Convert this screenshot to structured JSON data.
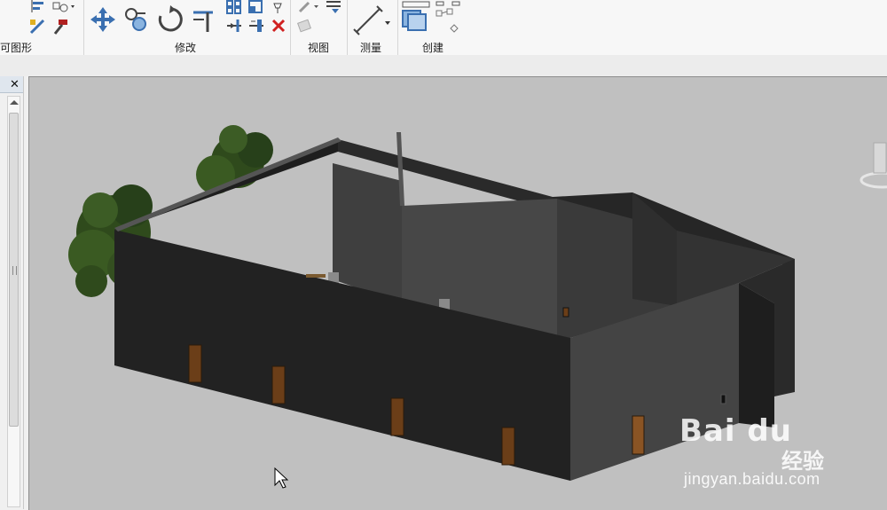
{
  "ribbon": {
    "panels": [
      {
        "label": "可图形"
      },
      {
        "label": "修改"
      },
      {
        "label": "视图"
      },
      {
        "label": "测量"
      },
      {
        "label": "创建"
      }
    ],
    "icons": [
      "align-icon",
      "copy-icon",
      "match-properties-icon",
      "demolish-icon",
      "move-icon",
      "offset-icon",
      "rotate-icon",
      "trim-icon",
      "array-icon",
      "scale-icon",
      "split-icon",
      "delete-icon",
      "pin-icon",
      "pencil-icon",
      "hide-icon",
      "measure-icon",
      "create-group-icon",
      "create-parts-icon"
    ]
  },
  "browser": {
    "close_label": "✕"
  },
  "watermark": {
    "logo": "Bai du",
    "text": "经验",
    "url": "jingyan.baidu.com"
  },
  "colors": {
    "viewport_bg": "#c0c0c0",
    "wall_dark": "#232323",
    "wall_mid": "#3e3e3e",
    "wall_light": "#4a4a4a",
    "door": "#6b3e18",
    "tree": "#2f4a1c"
  }
}
